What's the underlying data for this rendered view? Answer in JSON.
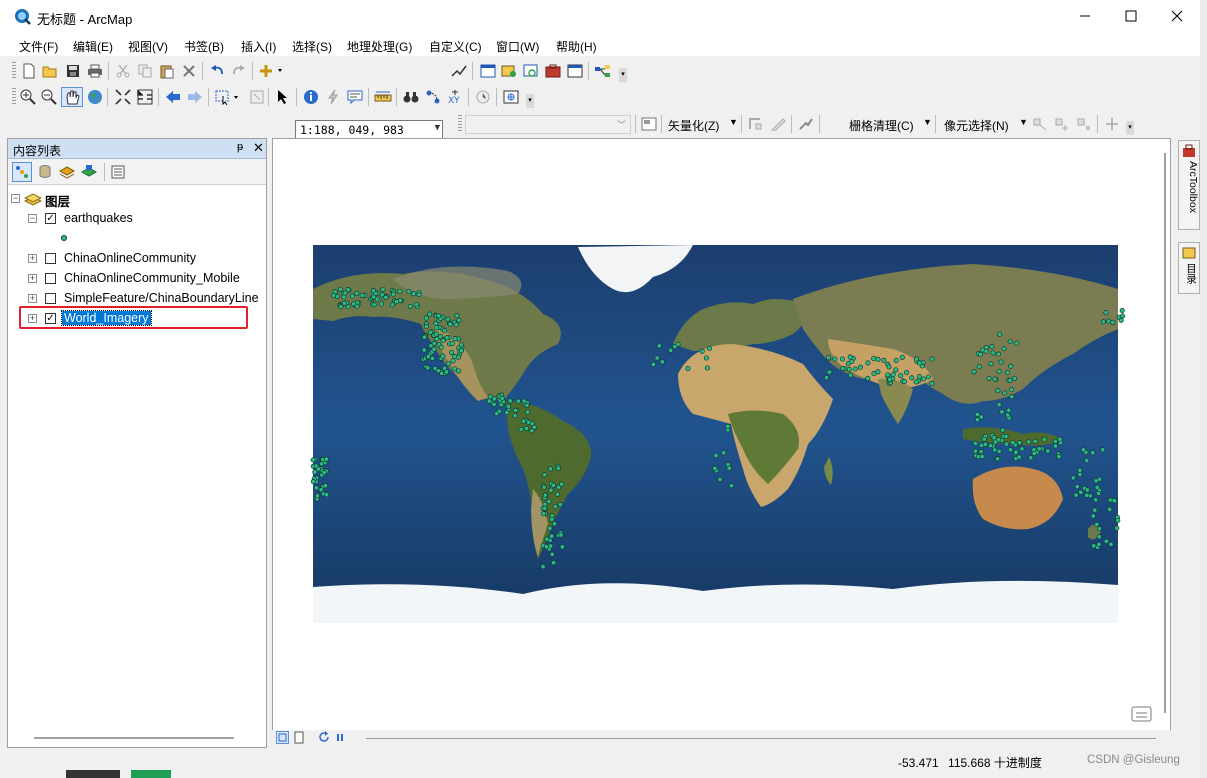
{
  "window": {
    "title": "无标题 - ArcMap",
    "minimize_icon": "minimize-icon",
    "maximize_icon": "maximize-icon",
    "close_icon": "close-icon"
  },
  "menu": [
    "文件(F)",
    "编辑(E)",
    "视图(V)",
    "书签(B)",
    "插入(I)",
    "选择(S)",
    "地理处理(G)",
    "自定义(C)",
    "窗口(W)",
    "帮助(H)"
  ],
  "toolbar": {
    "scale_value": "1:188, 049, 983",
    "vectorize_label": "矢量化(Z)",
    "raster_cleanup_label": "栅格清理(C)",
    "pixel_select_label": "像元选择(N)"
  },
  "toc": {
    "title": "内容列表",
    "root_label": "图层",
    "layers": [
      {
        "name": "earthquakes",
        "checked": true,
        "expanded": true
      },
      {
        "name": "ChinaOnlineCommunity",
        "checked": false,
        "expanded": false
      },
      {
        "name": "ChinaOnlineCommunity_Mobile",
        "checked": false,
        "expanded": false
      },
      {
        "name": "SimpleFeature/ChinaBoundaryLine",
        "checked": false,
        "expanded": false
      },
      {
        "name": "World_Imagery",
        "checked": true,
        "expanded": false,
        "selected": true
      }
    ]
  },
  "dock": {
    "arctoolbox": "ArcToolbox",
    "catalog": "目录"
  },
  "status": {
    "x": "-53.471",
    "y": "115.668",
    "units": "十进制度",
    "watermark": "CSDN @Gisleung"
  },
  "colors": {
    "point_fill": "#2fb889",
    "point_stroke": "#0b3d2a",
    "ocean": "#1b4f8e",
    "selection": "#0078d7",
    "annotation_box": "#e0212a"
  }
}
